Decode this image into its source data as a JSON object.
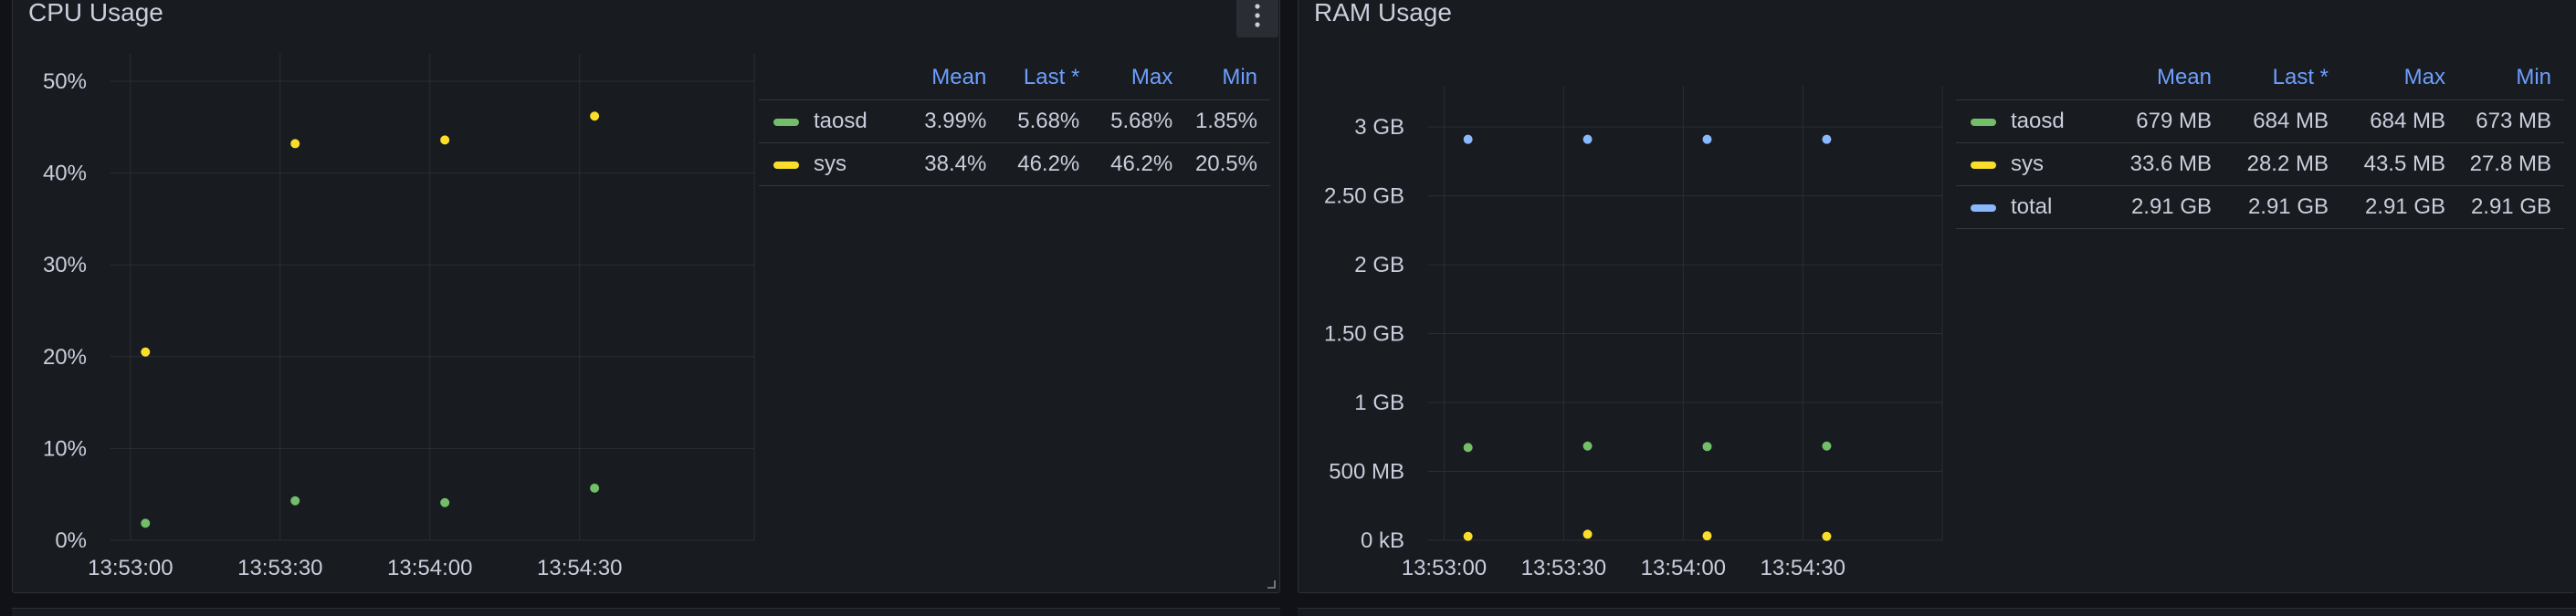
{
  "colors": {
    "taosd": "#73bf69",
    "sys": "#fade2a",
    "total": "#8ab8ff",
    "header": "#6e9fff",
    "grid": "#2b2e34"
  },
  "cpu_panel": {
    "title": "CPU Usage",
    "menu_icon": "kebab-menu-icon",
    "legend": {
      "headers": [
        "Mean",
        "Last *",
        "Max",
        "Min"
      ],
      "rows": [
        {
          "name": "taosd",
          "color": "#73bf69",
          "values": [
            "3.99%",
            "5.68%",
            "5.68%",
            "1.85%"
          ]
        },
        {
          "name": "sys",
          "color": "#fade2a",
          "values": [
            "38.4%",
            "46.2%",
            "46.2%",
            "20.5%"
          ]
        }
      ]
    }
  },
  "ram_panel": {
    "title": "RAM Usage",
    "legend": {
      "headers": [
        "Mean",
        "Last *",
        "Max",
        "Min"
      ],
      "rows": [
        {
          "name": "taosd",
          "color": "#73bf69",
          "values": [
            "679 MB",
            "684 MB",
            "684 MB",
            "673 MB"
          ]
        },
        {
          "name": "sys",
          "color": "#fade2a",
          "values": [
            "33.6 MB",
            "28.2 MB",
            "43.5 MB",
            "27.8 MB"
          ]
        },
        {
          "name": "total",
          "color": "#8ab8ff",
          "values": [
            "2.91 GB",
            "2.91 GB",
            "2.91 GB",
            "2.91 GB"
          ]
        }
      ]
    }
  },
  "chart_data": [
    {
      "type": "scatter",
      "title": "CPU Usage",
      "x": [
        "13:53:00",
        "13:53:30",
        "13:54:00",
        "13:54:30"
      ],
      "x_ticks": [
        "13:53:00",
        "13:53:30",
        "13:54:00",
        "13:54:30"
      ],
      "xlim": [
        "13:52:56",
        "13:55:05"
      ],
      "y_ticks": [
        "0%",
        "10%",
        "20%",
        "30%",
        "40%",
        "50%"
      ],
      "ylim": [
        0,
        50
      ],
      "y_unit": "percent",
      "series": [
        {
          "name": "taosd",
          "color": "#73bf69",
          "x": [
            "13:53:03",
            "13:53:33",
            "13:54:03",
            "13:54:33"
          ],
          "values": [
            1.85,
            4.3,
            4.1,
            5.68
          ]
        },
        {
          "name": "sys",
          "color": "#fade2a",
          "x": [
            "13:53:03",
            "13:53:33",
            "13:54:03",
            "13:54:33"
          ],
          "values": [
            20.5,
            43.2,
            43.6,
            46.2
          ]
        }
      ],
      "grid": true
    },
    {
      "type": "scatter",
      "title": "RAM Usage",
      "x_ticks": [
        "13:53:00",
        "13:53:30",
        "13:54:00",
        "13:54:30"
      ],
      "xlim": [
        "13:52:56",
        "13:55:05"
      ],
      "y_ticks": [
        "0 kB",
        "500 MB",
        "1 GB",
        "1.50 GB",
        "2 GB",
        "2.50 GB",
        "3 GB"
      ],
      "ylim": [
        0,
        3.1
      ],
      "y_unit": "GB",
      "series": [
        {
          "name": "taosd",
          "color": "#73bf69",
          "x": [
            "13:53:06",
            "13:53:36",
            "13:54:06",
            "13:54:36"
          ],
          "values": [
            0.673,
            0.684,
            0.68,
            0.684
          ]
        },
        {
          "name": "sys",
          "color": "#fade2a",
          "x": [
            "13:53:06",
            "13:53:36",
            "13:54:06",
            "13:54:36"
          ],
          "values": [
            0.028,
            0.0435,
            0.032,
            0.028
          ]
        },
        {
          "name": "total",
          "color": "#8ab8ff",
          "x": [
            "13:53:06",
            "13:53:36",
            "13:54:06",
            "13:54:36"
          ],
          "values": [
            2.91,
            2.91,
            2.91,
            2.91
          ]
        }
      ],
      "grid": true
    }
  ]
}
